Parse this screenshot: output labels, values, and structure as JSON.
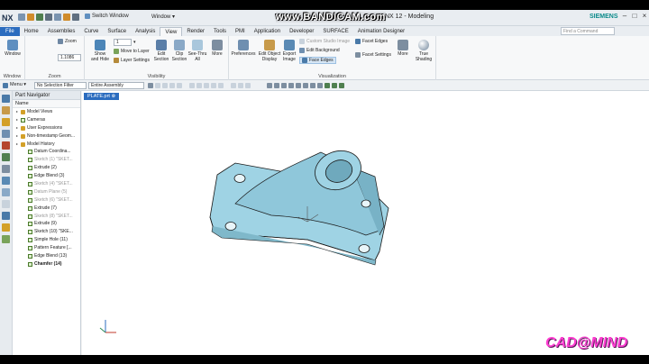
{
  "titlebar": {
    "app_logo": "NX",
    "switch_window": "Switch Window",
    "window_menu": "Window ▾",
    "recorder_watermark": "www.BANDICAM.com",
    "title": "NX 12 - Modeling",
    "vendor": "SIEMENS"
  },
  "tabs": [
    "File",
    "Home",
    "Assemblies",
    "Curve",
    "Surface",
    "Analysis",
    "View",
    "Render",
    "Tools",
    "PMI",
    "Application",
    "Developer",
    "SURFACE",
    "Animation Designer"
  ],
  "active_tab": "View",
  "search": {
    "placeholder": "Find a Command"
  },
  "ribbon": {
    "window": {
      "label": "Window",
      "group": "Window"
    },
    "zoom": {
      "label": "Zoom",
      "value": "1.1086",
      "group": "Zoom"
    },
    "visibility": {
      "show_hide": "Show and Hide",
      "layer_value": "1",
      "move_to_layer": "Move to Layer",
      "layer_settings": "Layer Settings",
      "edit_section": "Edit Section",
      "clip_section": "Clip Section",
      "see_thru_all": "See-Thru All",
      "more": "More",
      "group": "Visibility"
    },
    "visualization": {
      "preferences": "Preferences",
      "edit_object_display": "Edit Object Display",
      "export_image": "Export Image",
      "custom_studio_image": "Custom Studio Image",
      "edit_background": "Edit Background",
      "face_edges": "Face Edges",
      "facet_edges": "Facet Edges",
      "facet_settings": "Facet Settings",
      "more": "More",
      "true_shading": "True Shading",
      "group": "Visualization"
    }
  },
  "toolbar": {
    "menu": "Menu ▾",
    "selection_filter": "No Selection Filter",
    "assembly_scope": "Entire Assembly"
  },
  "navigator": {
    "title": "Part Navigator",
    "column": "Name",
    "items": [
      {
        "label": "Model Views",
        "indent": 1,
        "type": "folder"
      },
      {
        "label": "Cameras",
        "indent": 1,
        "type": "check"
      },
      {
        "label": "User Expressions",
        "indent": 1,
        "type": "folder"
      },
      {
        "label": "Non-timestamp Geom...",
        "indent": 1,
        "type": "folder"
      },
      {
        "label": "Model History",
        "indent": 1,
        "type": "folder"
      },
      {
        "label": "Datum Coordina...",
        "indent": 2,
        "type": "check"
      },
      {
        "label": "Sketch (1) \"SKET...",
        "indent": 2,
        "type": "check",
        "gray": true
      },
      {
        "label": "Extrude (2)",
        "indent": 2,
        "type": "check"
      },
      {
        "label": "Edge Blend (3)",
        "indent": 2,
        "type": "check"
      },
      {
        "label": "Sketch (4) \"SKET...",
        "indent": 2,
        "type": "check",
        "gray": true
      },
      {
        "label": "Datum Plane (5)",
        "indent": 2,
        "type": "check",
        "gray": true
      },
      {
        "label": "Sketch (6) \"SKET...",
        "indent": 2,
        "type": "check",
        "gray": true
      },
      {
        "label": "Extrude (7)",
        "indent": 2,
        "type": "check"
      },
      {
        "label": "Sketch (8) \"SKET...",
        "indent": 2,
        "type": "check",
        "gray": true
      },
      {
        "label": "Extrude (9)",
        "indent": 2,
        "type": "check"
      },
      {
        "label": "Sketch (10) \"SKE...",
        "indent": 2,
        "type": "check"
      },
      {
        "label": "Simple Hole (11)",
        "indent": 2,
        "type": "check"
      },
      {
        "label": "Pattern Feature [...",
        "indent": 2,
        "type": "check"
      },
      {
        "label": "Edge Blend (13)",
        "indent": 2,
        "type": "check"
      },
      {
        "label": "Chamfer (14)",
        "indent": 2,
        "type": "check",
        "bold": true
      }
    ]
  },
  "graphics": {
    "part_tab": "PLATE.prt ⊗",
    "brand_watermark": "CAD@MIND"
  },
  "colors": {
    "part_fill": "#9fd3e4",
    "part_edge": "#1a1a1a",
    "file_tab": "#2b6cbf",
    "watermark": "#ff3fd2"
  }
}
